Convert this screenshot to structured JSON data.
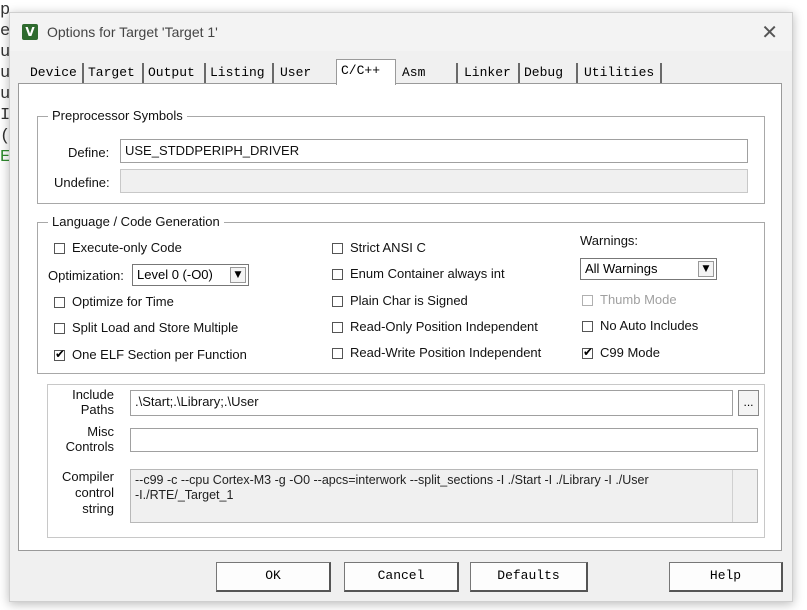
{
  "background_code": [
    "p",
    "e",
    "u",
    "u",
    "u",
    "I",
    "(",
    "E"
  ],
  "dialog": {
    "title": "Options for Target 'Target 1'",
    "icon_letter": "V",
    "close_glyph": "✕"
  },
  "tabs": [
    {
      "label": "Device",
      "active": false
    },
    {
      "label": "Target",
      "active": false
    },
    {
      "label": "Output",
      "active": false
    },
    {
      "label": "Listing",
      "active": false
    },
    {
      "label": "User",
      "active": false
    },
    {
      "label": "C/C++",
      "active": true
    },
    {
      "label": "Asm",
      "active": false
    },
    {
      "label": "Linker",
      "active": false
    },
    {
      "label": "Debug",
      "active": false
    },
    {
      "label": "Utilities",
      "active": false
    }
  ],
  "preprocessor": {
    "legend": "Preprocessor Symbols",
    "define_label": "Define:",
    "define_value": "USE_STDDPERIPH_DRIVER",
    "undefine_label": "Undefine:",
    "undefine_value": ""
  },
  "language": {
    "legend": "Language / Code Generation",
    "execute_only": {
      "label": "Execute-only Code",
      "checked": false
    },
    "optimization_label": "Optimization:",
    "optimization_value": "Level 0 (-O0)",
    "optimize_time": {
      "label": "Optimize for Time",
      "checked": false
    },
    "split_load": {
      "label": "Split Load and Store Multiple",
      "checked": false
    },
    "one_elf": {
      "label": "One ELF Section per Function",
      "checked": true
    },
    "strict_ansi": {
      "label": "Strict ANSI C",
      "checked": false
    },
    "enum_container": {
      "label": "Enum Container always int",
      "checked": false
    },
    "plain_char": {
      "label": "Plain Char is Signed",
      "checked": false
    },
    "ro_pos": {
      "label": "Read-Only Position Independent",
      "checked": false
    },
    "rw_pos": {
      "label": "Read-Write Position Independent",
      "checked": false
    },
    "warnings_label": "Warnings:",
    "warnings_value": "All Warnings",
    "thumb_mode": {
      "label": "Thumb Mode",
      "checked": false,
      "disabled": true
    },
    "no_auto_includes": {
      "label": "No Auto Includes",
      "checked": false
    },
    "c99_mode": {
      "label": "C99 Mode",
      "checked": true
    }
  },
  "include": {
    "label_line1": "Include",
    "label_line2": "Paths",
    "value": ".\\Start;.\\Library;.\\User",
    "browse_label": "..."
  },
  "misc": {
    "label_line1": "Misc",
    "label_line2": "Controls",
    "value": ""
  },
  "compiler": {
    "label_line1": "Compiler",
    "label_line2": "control",
    "label_line3": "string",
    "line1": "--c99 -c --cpu Cortex-M3 -g -O0 --apcs=interwork --split_sections -I ./Start -I ./Library -I ./User",
    "line2": "-I./RTE/_Target_1"
  },
  "buttons": {
    "ok": "OK",
    "cancel": "Cancel",
    "defaults": "Defaults",
    "help": "Help"
  }
}
